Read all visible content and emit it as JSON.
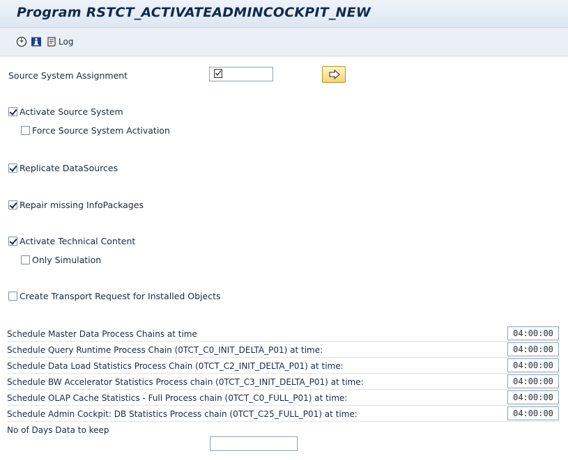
{
  "window": {
    "title": "Program RSTCT_ACTIVATEADMINCOCKPIT_NEW"
  },
  "toolbar": {
    "execute_icon": "execute-icon",
    "info_icon": "info-icon",
    "log_label": "Log",
    "log_icon": "log-icon"
  },
  "form": {
    "source_system_label": "Source System Assignment",
    "source_system_value": "",
    "activate_source_system": {
      "label": "Activate Source System",
      "checked": true
    },
    "force_activation": {
      "label": "Force Source System Activation",
      "checked": false
    },
    "replicate_datasources": {
      "label": "Replicate DataSources",
      "checked": true
    },
    "repair_infopackages": {
      "label": "Repair missing InfoPackages",
      "checked": true
    },
    "activate_technical_content": {
      "label": "Activate Technical Content",
      "checked": true
    },
    "only_simulation": {
      "label": "Only Simulation",
      "checked": false
    },
    "create_transport": {
      "label": "Create Transport Request for Installed Objects",
      "checked": false
    }
  },
  "schedules": [
    {
      "label": "Schedule  Master Data Process Chains at time",
      "time": "04:00:00"
    },
    {
      "label": "Schedule Query Runtime Process Chain (0TCT_C0_INIT_DELTA_P01) at time:",
      "time": "04:00:00"
    },
    {
      "label": "Schedule Data Load Statistics  Process Chain (0TCT_C2_INIT_DELTA_P01) at time:",
      "time": "04:00:00"
    },
    {
      "label": "Schedule BW Accelerator Statistics Process chain (0TCT_C3_INIT_DELTA_P01) at time:",
      "time": "04:00:00"
    },
    {
      "label": "Schedule OLAP Cache Statistics - Full Process chain (0TCT_C0_FULL_P01) at time:",
      "time": "04:00:00"
    },
    {
      "label": "Schedule Admin Cockpit:  DB Statistics Process chain (0TCT_C25_FULL_P01) at time:",
      "time": "04:00:00"
    }
  ],
  "days_to_keep": {
    "label": "No of Days Data to keep",
    "value": ""
  }
}
